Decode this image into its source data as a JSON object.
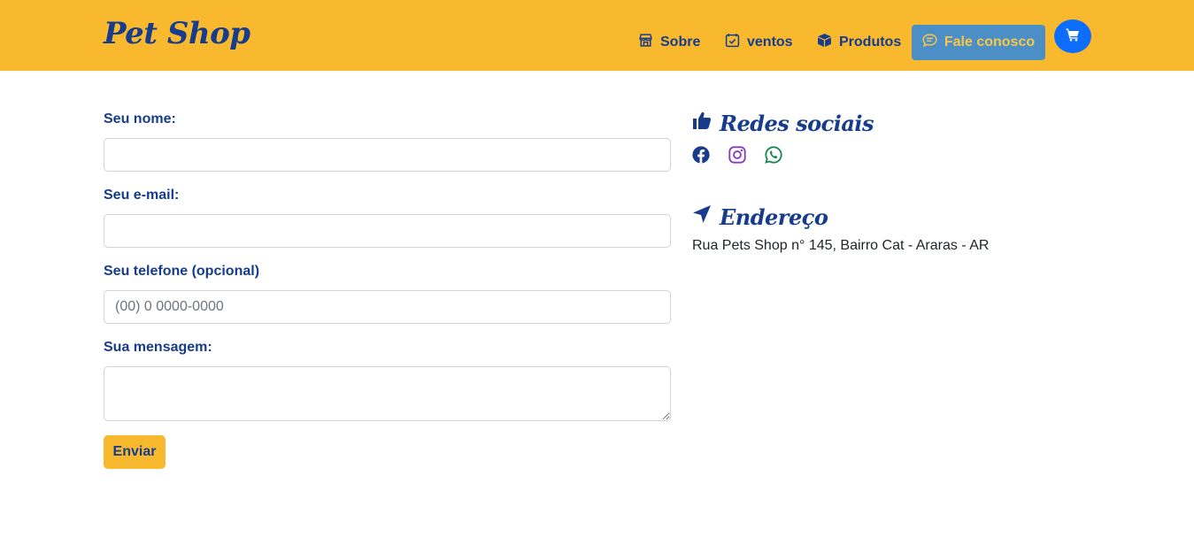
{
  "navbar": {
    "brand": "Pet Shop",
    "links": [
      {
        "label": "Sobre",
        "icon": "store-icon"
      },
      {
        "label": "ventos",
        "icon": "calendar-check-icon"
      },
      {
        "label": "Produtos",
        "icon": "box-icon"
      }
    ],
    "contact": {
      "label": "Fale conosco",
      "icon": "chat-icon"
    },
    "cart": {
      "icon": "cart-icon"
    },
    "colors": {
      "background": "#f8b92e",
      "text": "#173c8c",
      "contact_bg": "#4b8fc6",
      "contact_text": "#f8c74a",
      "cart_bg": "#0d6efd"
    }
  },
  "form": {
    "name": {
      "label": "Seu nome:",
      "value": "",
      "placeholder": ""
    },
    "email": {
      "label": "Seu e-mail:",
      "value": "",
      "placeholder": ""
    },
    "phone": {
      "label": "Seu telefone (opcional)",
      "value": "",
      "placeholder": "(00) 0 0000-0000"
    },
    "message": {
      "label": "Sua mensagem:",
      "value": ""
    },
    "submit": "Enviar"
  },
  "sidebar": {
    "social": {
      "title": "Redes sociais",
      "icon": "thumbs-up-icon",
      "links": [
        {
          "name": "facebook-icon",
          "color": "#173c8c"
        },
        {
          "name": "instagram-icon",
          "color": "#8a3ab9"
        },
        {
          "name": "whatsapp-icon",
          "color": "#198754"
        }
      ]
    },
    "address": {
      "title": "Endereço",
      "icon": "location-arrow-icon",
      "text": "Rua Pets Shop n° 145, Bairro Cat - Araras - AR"
    }
  }
}
